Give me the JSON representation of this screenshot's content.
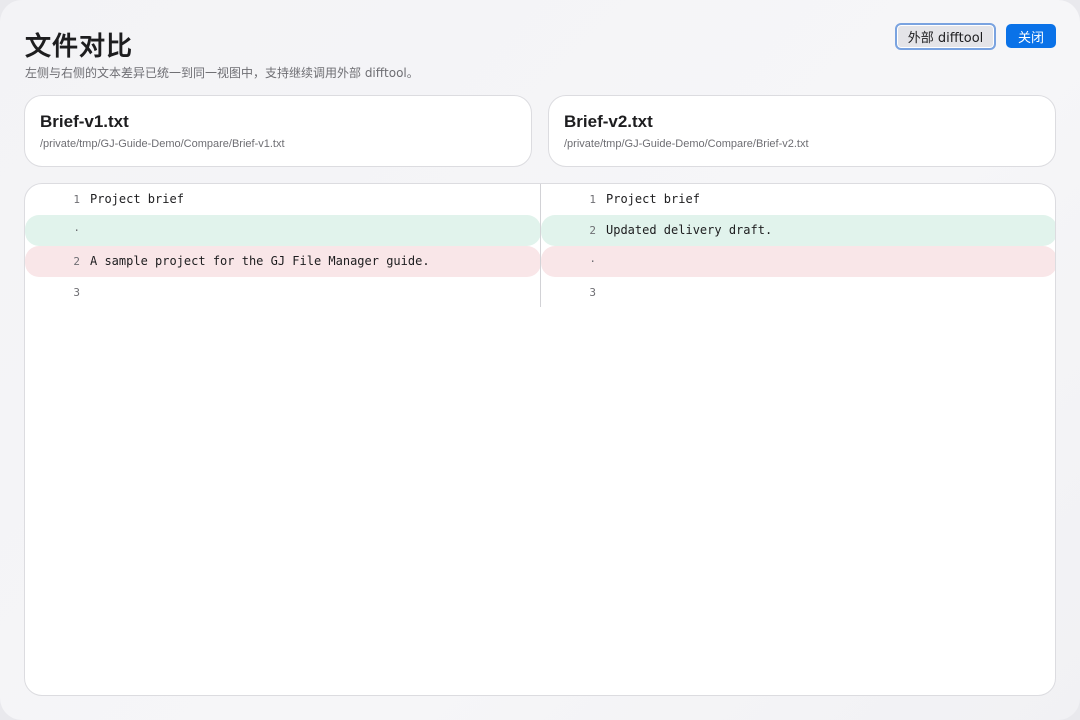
{
  "header": {
    "title": "文件对比",
    "subtitle": "左侧与右侧的文本差异已统一到同一视图中，支持继续调用外部 difftool。",
    "external_button": "外部 difftool",
    "close_button": "关闭"
  },
  "left_file": {
    "name": "Brief-v1.txt",
    "path": "/private/tmp/GJ-Guide-Demo/Compare/Brief-v1.txt"
  },
  "right_file": {
    "name": "Brief-v2.txt",
    "path": "/private/tmp/GJ-Guide-Demo/Compare/Brief-v2.txt"
  },
  "diff": {
    "left_rows": [
      {
        "num": "1",
        "text": "Project brief",
        "state": "normal"
      },
      {
        "num": "·",
        "text": "",
        "state": "added"
      },
      {
        "num": "2",
        "text": "A sample project for the GJ File Manager guide.",
        "state": "removed"
      },
      {
        "num": "3",
        "text": "",
        "state": "normal"
      }
    ],
    "right_rows": [
      {
        "num": "1",
        "text": "Project brief",
        "state": "normal"
      },
      {
        "num": "2",
        "text": "Updated delivery draft.",
        "state": "added"
      },
      {
        "num": "·",
        "text": "",
        "state": "removed"
      },
      {
        "num": "3",
        "text": "",
        "state": "normal"
      }
    ]
  },
  "colors": {
    "accent": "#0a72e8",
    "added_bg": "#e1f3ec",
    "removed_bg": "#f9e6e8"
  }
}
